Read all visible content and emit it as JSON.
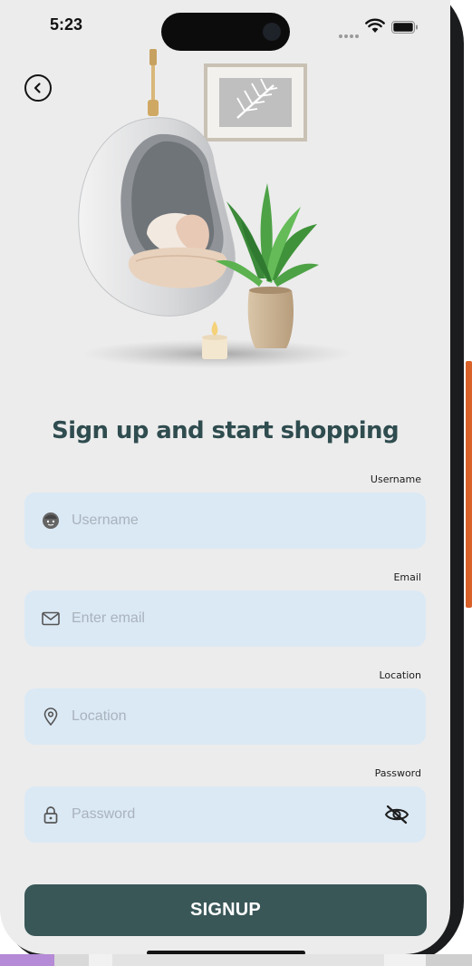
{
  "status_bar": {
    "time": "5:23",
    "icons": [
      "signal-dots-icon",
      "wifi-icon",
      "battery-icon"
    ]
  },
  "header": {
    "back_icon": "chevron-left-icon"
  },
  "illustration": {
    "subject": "hanging egg chair with plant, candle and framed picture"
  },
  "title": "Sign up and start shopping",
  "form": {
    "username": {
      "label": "Username",
      "placeholder": "Username",
      "value": "",
      "icon": "user-avatar-icon"
    },
    "email": {
      "label": "Email",
      "placeholder": "Enter email",
      "value": "",
      "icon": "mail-icon"
    },
    "location": {
      "label": "Location",
      "placeholder": "Location",
      "value": "",
      "icon": "location-pin-icon"
    },
    "password": {
      "label": "Password",
      "placeholder": "Password",
      "value": "",
      "icon": "lock-icon",
      "toggle_icon": "eye-off-icon"
    }
  },
  "signup_button": {
    "label": "SIGNUP"
  },
  "colors": {
    "primary": "#3a5758",
    "title": "#2f4c4f",
    "field_bg": "#dbe9f5",
    "screen_bg": "#ececec",
    "placeholder": "#a9b3bd"
  }
}
